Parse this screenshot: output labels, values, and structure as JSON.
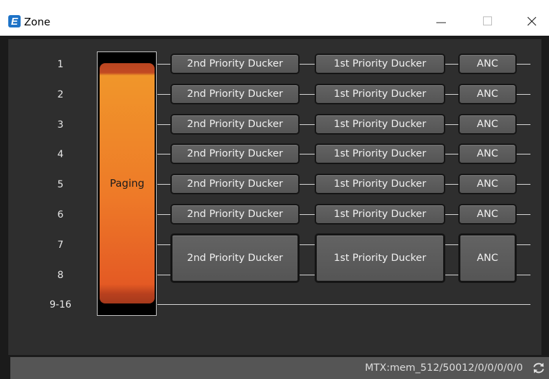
{
  "window": {
    "title": "Zone",
    "app_icon": "zone-app-icon",
    "app_icon_glyph": "E",
    "controls": [
      "minimize-icon",
      "maximize-icon",
      "close-icon"
    ]
  },
  "zone_rows": [
    {
      "label": "1",
      "second_ducker": "2nd Priority Ducker",
      "first_ducker": "1st Priority Ducker",
      "anc": "ANC"
    },
    {
      "label": "2",
      "second_ducker": "2nd Priority Ducker",
      "first_ducker": "1st Priority Ducker",
      "anc": "ANC"
    },
    {
      "label": "3",
      "second_ducker": "2nd Priority Ducker",
      "first_ducker": "1st Priority Ducker",
      "anc": "ANC"
    },
    {
      "label": "4",
      "second_ducker": "2nd Priority Ducker",
      "first_ducker": "1st Priority Ducker",
      "anc": "ANC"
    },
    {
      "label": "5",
      "second_ducker": "2nd Priority Ducker",
      "first_ducker": "1st Priority Ducker",
      "anc": "ANC"
    },
    {
      "label": "6",
      "second_ducker": "2nd Priority Ducker",
      "first_ducker": "1st Priority Ducker",
      "anc": "ANC"
    }
  ],
  "zone_pair": {
    "labels": [
      "7",
      "8"
    ],
    "second_ducker": "2nd Priority Ducker",
    "first_ducker": "1st Priority Ducker",
    "anc": "ANC"
  },
  "zone_range": {
    "label": "9-16"
  },
  "paging": {
    "label": "Paging"
  },
  "status": {
    "text": "MTX:mem_512/50012/0/0/0/0/0",
    "refresh_icon": "refresh-icon"
  },
  "colors": {
    "panel_bg": "#2e2e2e",
    "button_bg": "#5a5a5a",
    "paging_orange": "#ee7a28",
    "statusbar_bg": "#555555"
  }
}
